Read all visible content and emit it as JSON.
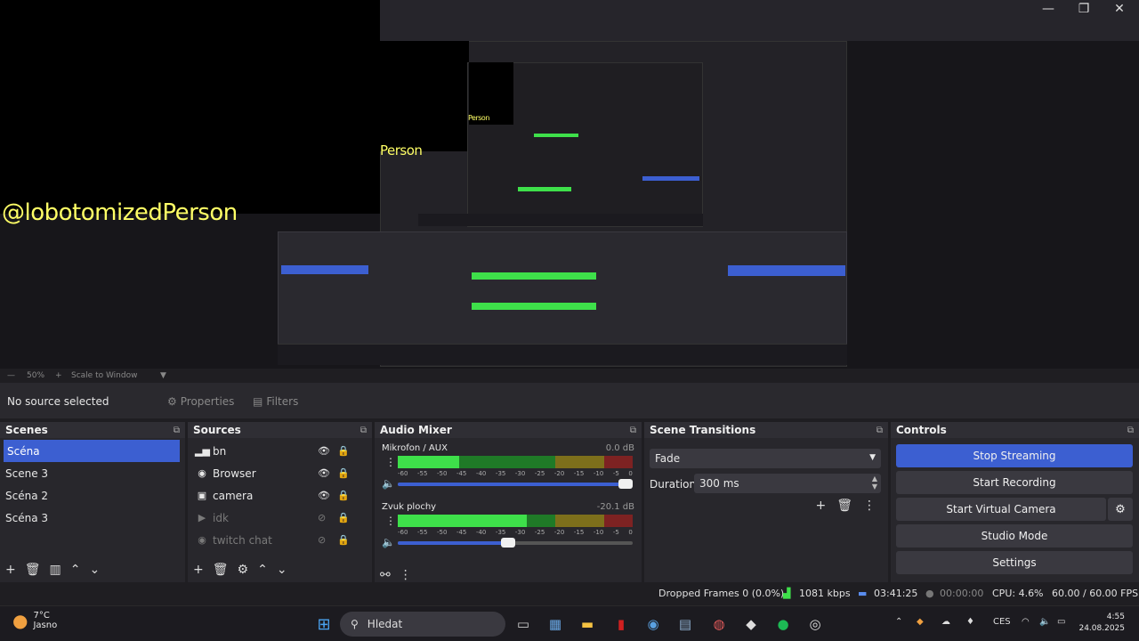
{
  "preview": {
    "handle_text": "@lobotomizedPerson",
    "handle_partial": "Person"
  },
  "zoom": {
    "percent": "50%",
    "mode": "Scale to Window"
  },
  "context": {
    "selection": "No source selected",
    "properties_label": "Properties",
    "filters_label": "Filters"
  },
  "docks": {
    "scenes": {
      "title": "Scenes",
      "items": [
        {
          "label": "Scéna"
        },
        {
          "label": "Scene 3"
        },
        {
          "label": "Scéna 2"
        },
        {
          "label": "Scéna 3"
        }
      ]
    },
    "sources": {
      "title": "Sources",
      "items": [
        {
          "label": "bn",
          "icon": "audio-bars-icon",
          "visible": true
        },
        {
          "label": "Browser",
          "icon": "globe-icon",
          "visible": true
        },
        {
          "label": "camera",
          "icon": "camera-icon",
          "visible": true
        },
        {
          "label": "idk",
          "icon": "play-icon",
          "visible": false
        },
        {
          "label": "twitch chat",
          "icon": "globe-icon",
          "visible": false
        }
      ]
    },
    "audio": {
      "title": "Audio Mixer",
      "channels": [
        {
          "name": "Mikrofon / AUX",
          "db": "0.0 dB",
          "level": 0.26,
          "volume": 1.0
        },
        {
          "name": "Zvuk plochy",
          "db": "-20.1 dB",
          "level": 0.55,
          "volume": 0.5
        }
      ],
      "ticks": [
        "-60",
        "-55",
        "-50",
        "-45",
        "-40",
        "-35",
        "-30",
        "-25",
        "-20",
        "-15",
        "-10",
        "-5",
        "0"
      ]
    },
    "transitions": {
      "title": "Scene Transitions",
      "selected": "Fade",
      "duration_label": "Duration",
      "duration_value": "300 ms"
    },
    "controls": {
      "title": "Controls",
      "stop_streaming": "Stop Streaming",
      "start_recording": "Start Recording",
      "start_virtual_camera": "Start Virtual Camera",
      "studio_mode": "Studio Mode",
      "settings": "Settings"
    }
  },
  "status": {
    "dropped": "Dropped Frames 0 (0.0%)",
    "kbps": "1081 kbps",
    "stream_time": "03:41:25",
    "rec_time": "00:00:00",
    "cpu": "CPU: 4.6%",
    "fps": "60.00 / 60.00 FPS"
  },
  "taskbar": {
    "temp": "7°C",
    "city": "Jasno",
    "search_placeholder": "Hledat",
    "lang": "CES",
    "time": "4:55",
    "date": "24.08.2025"
  },
  "colors": {
    "accent": "#3c5fd1",
    "meter_green": "#3ee04a",
    "meter_yellow": "#c9b42a",
    "meter_red": "#d03a3a",
    "handle_yellow": "#ffff66"
  }
}
